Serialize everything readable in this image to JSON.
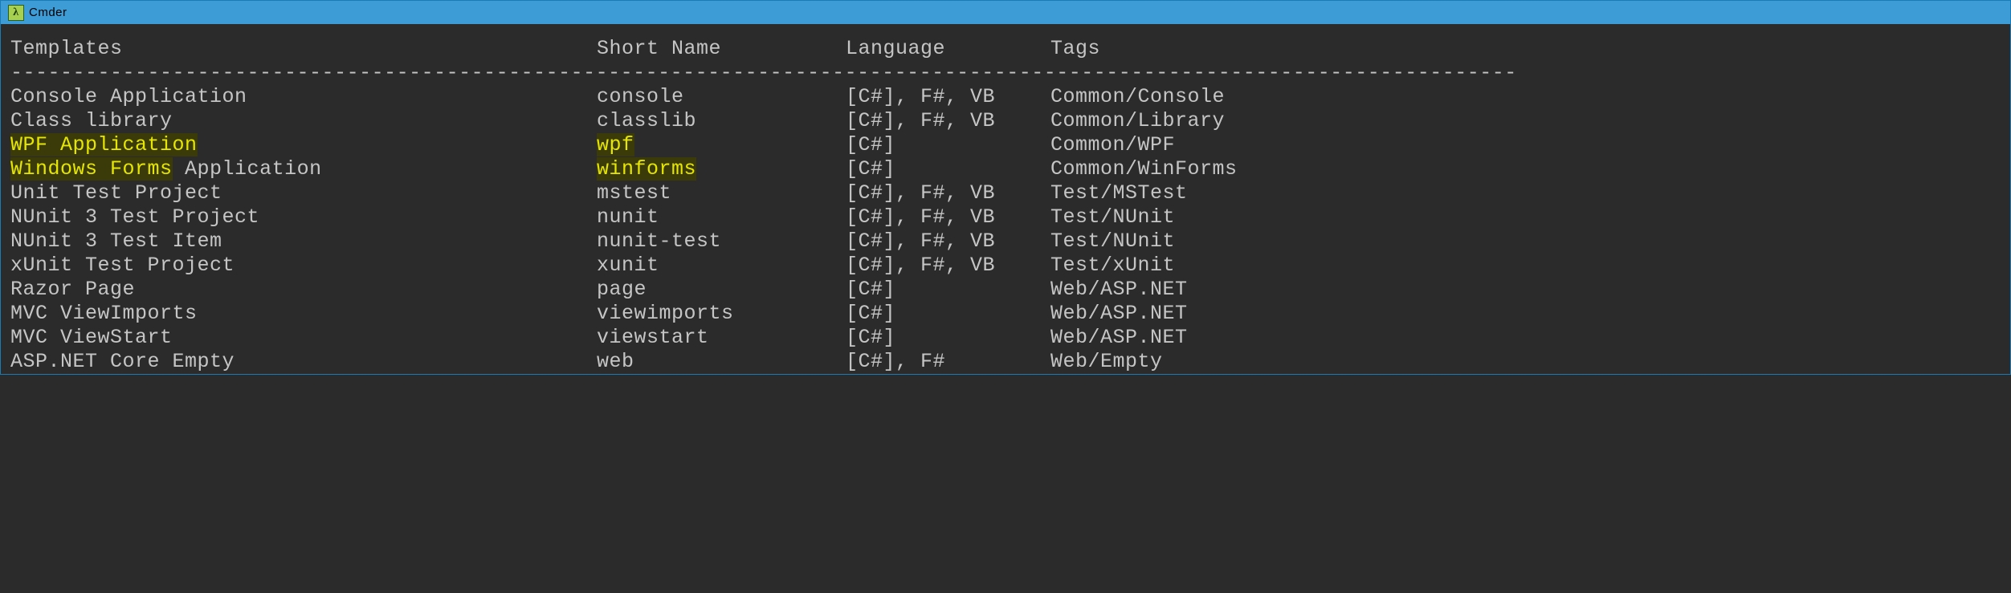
{
  "window": {
    "title": "Cmder",
    "icon_glyph": "λ"
  },
  "headers": {
    "templates": "Templates",
    "shortname": "Short Name",
    "language": "Language",
    "tags": "Tags"
  },
  "separator": "-------------------------------------------------------------------------------------------------------------------------",
  "rows": [
    {
      "templates": [
        {
          "t": "Console Application"
        }
      ],
      "shortname": [
        {
          "t": "console"
        }
      ],
      "language": "[C#], F#, VB",
      "tags": "Common/Console"
    },
    {
      "templates": [
        {
          "t": "Class library"
        }
      ],
      "shortname": [
        {
          "t": "classlib"
        }
      ],
      "language": "[C#], F#, VB",
      "tags": "Common/Library"
    },
    {
      "templates": [
        {
          "t": "WPF Application",
          "hl": true
        }
      ],
      "shortname": [
        {
          "t": "wpf",
          "hl": true
        }
      ],
      "language": "[C#]",
      "tags": "Common/WPF"
    },
    {
      "templates": [
        {
          "t": "Windows Forms",
          "hl": true
        },
        {
          "t": " Application"
        }
      ],
      "shortname": [
        {
          "t": "winforms",
          "hl": true
        }
      ],
      "language": "[C#]",
      "tags": "Common/WinForms"
    },
    {
      "templates": [
        {
          "t": "Unit Test Project"
        }
      ],
      "shortname": [
        {
          "t": "mstest"
        }
      ],
      "language": "[C#], F#, VB",
      "tags": "Test/MSTest"
    },
    {
      "templates": [
        {
          "t": "NUnit 3 Test Project"
        }
      ],
      "shortname": [
        {
          "t": "nunit"
        }
      ],
      "language": "[C#], F#, VB",
      "tags": "Test/NUnit"
    },
    {
      "templates": [
        {
          "t": "NUnit 3 Test Item"
        }
      ],
      "shortname": [
        {
          "t": "nunit-test"
        }
      ],
      "language": "[C#], F#, VB",
      "tags": "Test/NUnit"
    },
    {
      "templates": [
        {
          "t": "xUnit Test Project"
        }
      ],
      "shortname": [
        {
          "t": "xunit"
        }
      ],
      "language": "[C#], F#, VB",
      "tags": "Test/xUnit"
    },
    {
      "templates": [
        {
          "t": "Razor Page"
        }
      ],
      "shortname": [
        {
          "t": "page"
        }
      ],
      "language": "[C#]",
      "tags": "Web/ASP.NET"
    },
    {
      "templates": [
        {
          "t": "MVC ViewImports"
        }
      ],
      "shortname": [
        {
          "t": "viewimports"
        }
      ],
      "language": "[C#]",
      "tags": "Web/ASP.NET"
    },
    {
      "templates": [
        {
          "t": "MVC ViewStart"
        }
      ],
      "shortname": [
        {
          "t": "viewstart"
        }
      ],
      "language": "[C#]",
      "tags": "Web/ASP.NET"
    },
    {
      "templates": [
        {
          "t": "ASP.NET Core Empty"
        }
      ],
      "shortname": [
        {
          "t": "web"
        }
      ],
      "language": "[C#], F#",
      "tags": "Web/Empty"
    }
  ]
}
